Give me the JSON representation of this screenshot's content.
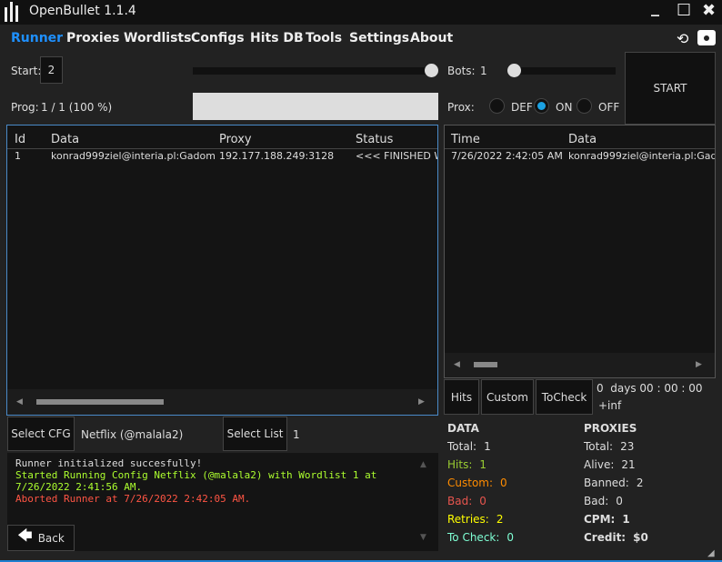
{
  "window": {
    "title": "OpenBullet 1.1.4",
    "minimize": "_",
    "maximize": "☐",
    "close": "✖"
  },
  "nav": [
    {
      "label": "Runner"
    },
    {
      "label": "Proxies"
    },
    {
      "label": "Wordlists"
    },
    {
      "label": "Configs"
    },
    {
      "label": "Hits DB"
    },
    {
      "label": "Tools"
    },
    {
      "label": "Settings"
    },
    {
      "label": "About"
    }
  ],
  "controls": {
    "start_label": "Start:",
    "start_value": "2",
    "bots_label": "Bots:",
    "bots_value": "1",
    "prog_label": "Prog:",
    "prog_value": "1 / 1 (100 %)",
    "progress_percent": 100,
    "prox_label": "Prox:",
    "prox_options": [
      "DEF",
      "ON",
      "OFF"
    ],
    "prox_selected": "ON",
    "start_button": "START"
  },
  "runner_table": {
    "columns": [
      "Id",
      "Data",
      "Proxy",
      "Status"
    ],
    "rows": [
      [
        "1",
        "konrad999ziel@interia.pl:Gadom",
        "192.177.188.249:3128",
        "<<< FINISHED W"
      ]
    ]
  },
  "hits_table": {
    "columns": [
      "Time",
      "Data"
    ],
    "rows": [
      [
        "7/26/2022 2:42:05 AM",
        "konrad999ziel@interia.pl:Gadc"
      ]
    ]
  },
  "hit_buttons": [
    "Hits",
    "Custom",
    "ToCheck"
  ],
  "timer": {
    "elapsed": "0  days 00 : 00 : 00",
    "remaining": "+inf"
  },
  "config": {
    "select_cfg": "Select CFG",
    "cfg_name": "Netflix (@malala2)",
    "select_list": "Select List",
    "list_name": "1"
  },
  "log": [
    {
      "text": "Runner initialized succesfully!",
      "color": "#dddddd"
    },
    {
      "text": "Started Running Config Netflix (@malala2) with Wordlist 1 at 7/26/2022 2:41:56 AM.",
      "color": "#adff2f"
    },
    {
      "text": "Aborted Runner at 7/26/2022 2:42:05 AM.",
      "color": "#ff5544"
    }
  ],
  "back_button": "Back",
  "data_stats": {
    "title": "DATA",
    "items": [
      {
        "label": "Total:",
        "value": "1",
        "color": "#dddddd"
      },
      {
        "label": "Hits:",
        "value": "1",
        "color": "#9acd32"
      },
      {
        "label": "Custom:",
        "value": "0",
        "color": "#ff8c00"
      },
      {
        "label": "Bad:",
        "value": "0",
        "color": "#e8554e"
      },
      {
        "label": "Retries:",
        "value": "2",
        "color": "#ffff00"
      },
      {
        "label": "To Check:",
        "value": "0",
        "color": "#7fffd4"
      }
    ]
  },
  "proxy_stats": {
    "title": "PROXIES",
    "items": [
      {
        "label": "Total:",
        "value": "23",
        "bold": false
      },
      {
        "label": "Alive:",
        "value": "21",
        "bold": false
      },
      {
        "label": "Banned:",
        "value": "2",
        "bold": false
      },
      {
        "label": "Bad:",
        "value": "0",
        "bold": false
      },
      {
        "label": "CPM:",
        "value": "1",
        "bold": true
      },
      {
        "label": "Credit:",
        "value": "$0",
        "bold": true
      }
    ]
  }
}
